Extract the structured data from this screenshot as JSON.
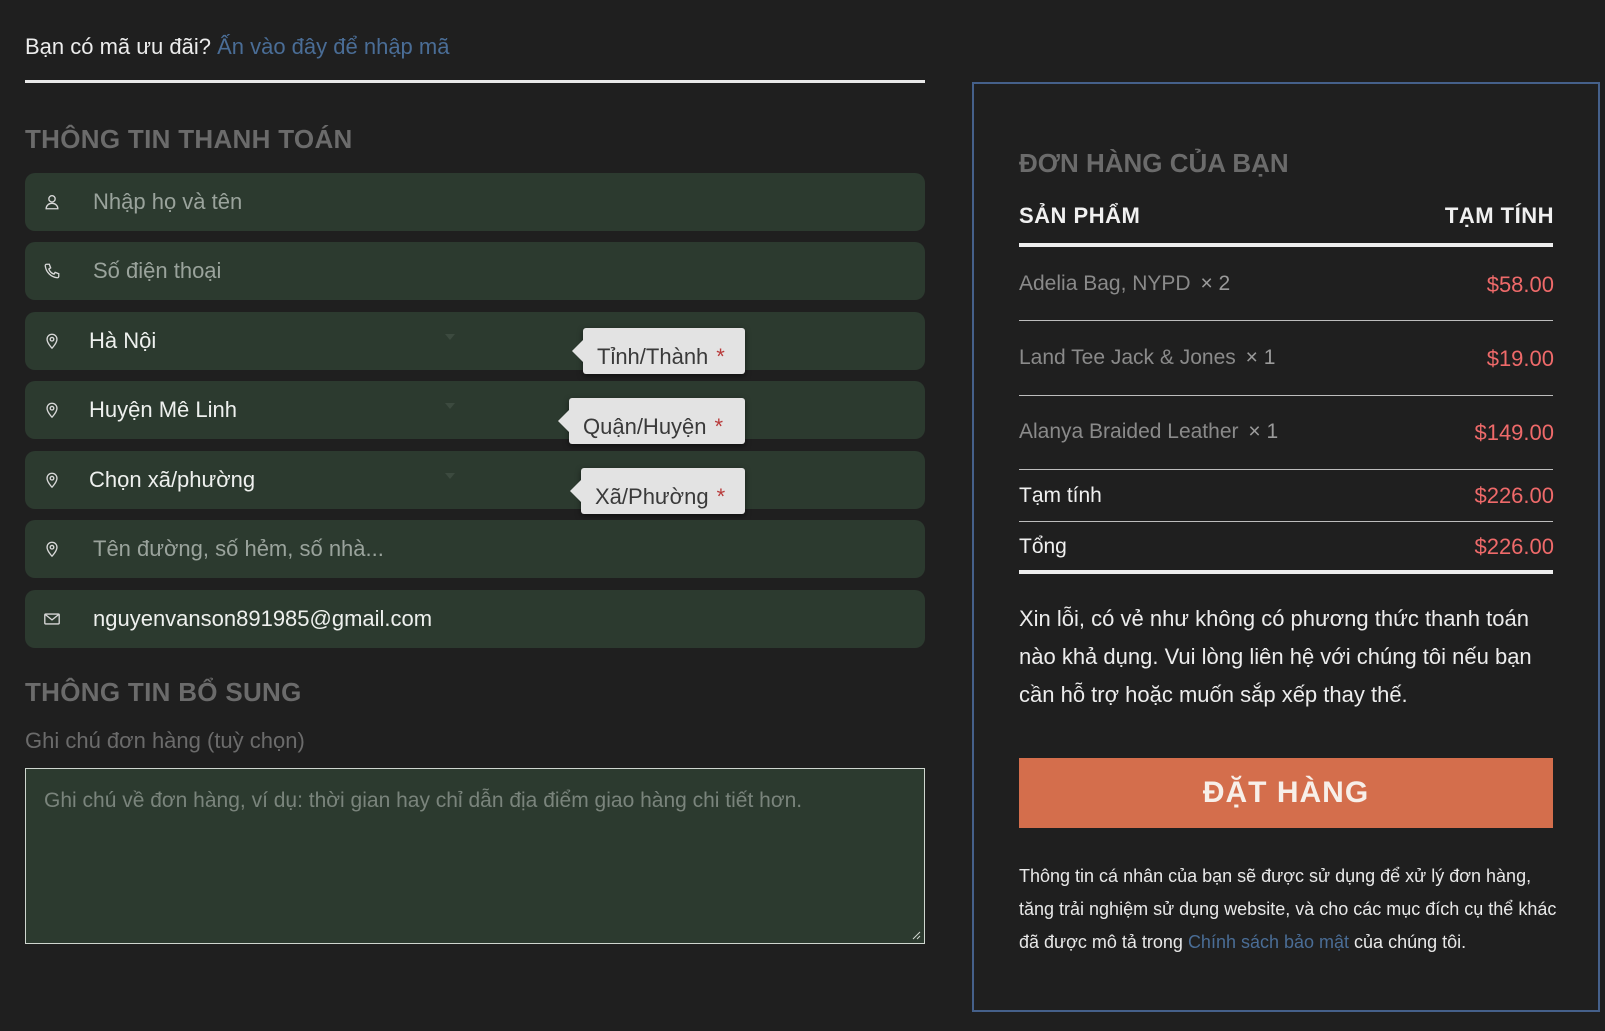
{
  "coupon": {
    "question": "Bạn có mã ưu đãi?",
    "link": "Ấn vào đây để nhập mã"
  },
  "billing": {
    "title": "THÔNG TIN THANH TOÁN",
    "name_placeholder": "Nhập họ và tên",
    "phone_placeholder": "Số điện thoại",
    "province_value": "Hà Nội",
    "province_label": "Tỉnh/Thành",
    "district_value": "Huyện Mê Linh",
    "district_label": "Quận/Huyện",
    "ward_value": "Chọn xã/phường",
    "ward_label": "Xã/Phường",
    "required_mark": "*",
    "address_placeholder": "Tên đường, số hẻm, số nhà...",
    "email_value": "nguyenvanson891985@gmail.com"
  },
  "additional": {
    "title": "THÔNG TIN BỔ SUNG",
    "notes_label": "Ghi chú đơn hàng (tuỳ chọn)",
    "notes_placeholder": "Ghi chú về đơn hàng, ví dụ: thời gian hay chỉ dẫn địa điểm giao hàng chi tiết hơn."
  },
  "order": {
    "title": "ĐƠN HÀNG CỦA BẠN",
    "col_product": "SẢN PHẨM",
    "col_subtotal": "TẠM TÍNH",
    "items": [
      {
        "name": "Adelia Bag, NYPD",
        "qty": "× 2",
        "price": "$58.00"
      },
      {
        "name": "Land Tee Jack & Jones",
        "qty": "× 1",
        "price": "$19.00"
      },
      {
        "name": "Alanya Braided Leather",
        "qty": "× 1",
        "price": "$149.00"
      }
    ],
    "subtotal_label": "Tạm tính",
    "subtotal_value": "$226.00",
    "total_label": "Tổng",
    "total_value": "$226.00",
    "sorry_text": "Xin lỗi, có vẻ như không có phương thức thanh toán nào khả dụng. Vui lòng liên hệ với chúng tôi nếu bạn cần hỗ trợ hoặc muốn sắp xếp thay thế.",
    "place_order_label": "ĐẶT HÀNG",
    "privacy_before": "Thông tin cá nhân của bạn sẽ được sử dụng để xử lý đơn hàng, tăng trải nghiệm sử dụng website, và cho các mục đích cụ thể khác đã được mô tả trong ",
    "privacy_link": "Chính sách bảo mật",
    "privacy_after": " của chúng tôi."
  },
  "colors": {
    "background": "#1f1f1f",
    "field_bg": "#2c3a2f",
    "link": "#4a6d96",
    "price": "#ef6a6a",
    "button": "#d46e4c",
    "box_border": "#45608a"
  },
  "icons": [
    "user-icon",
    "phone-icon",
    "map-pin-icon",
    "mail-icon"
  ]
}
